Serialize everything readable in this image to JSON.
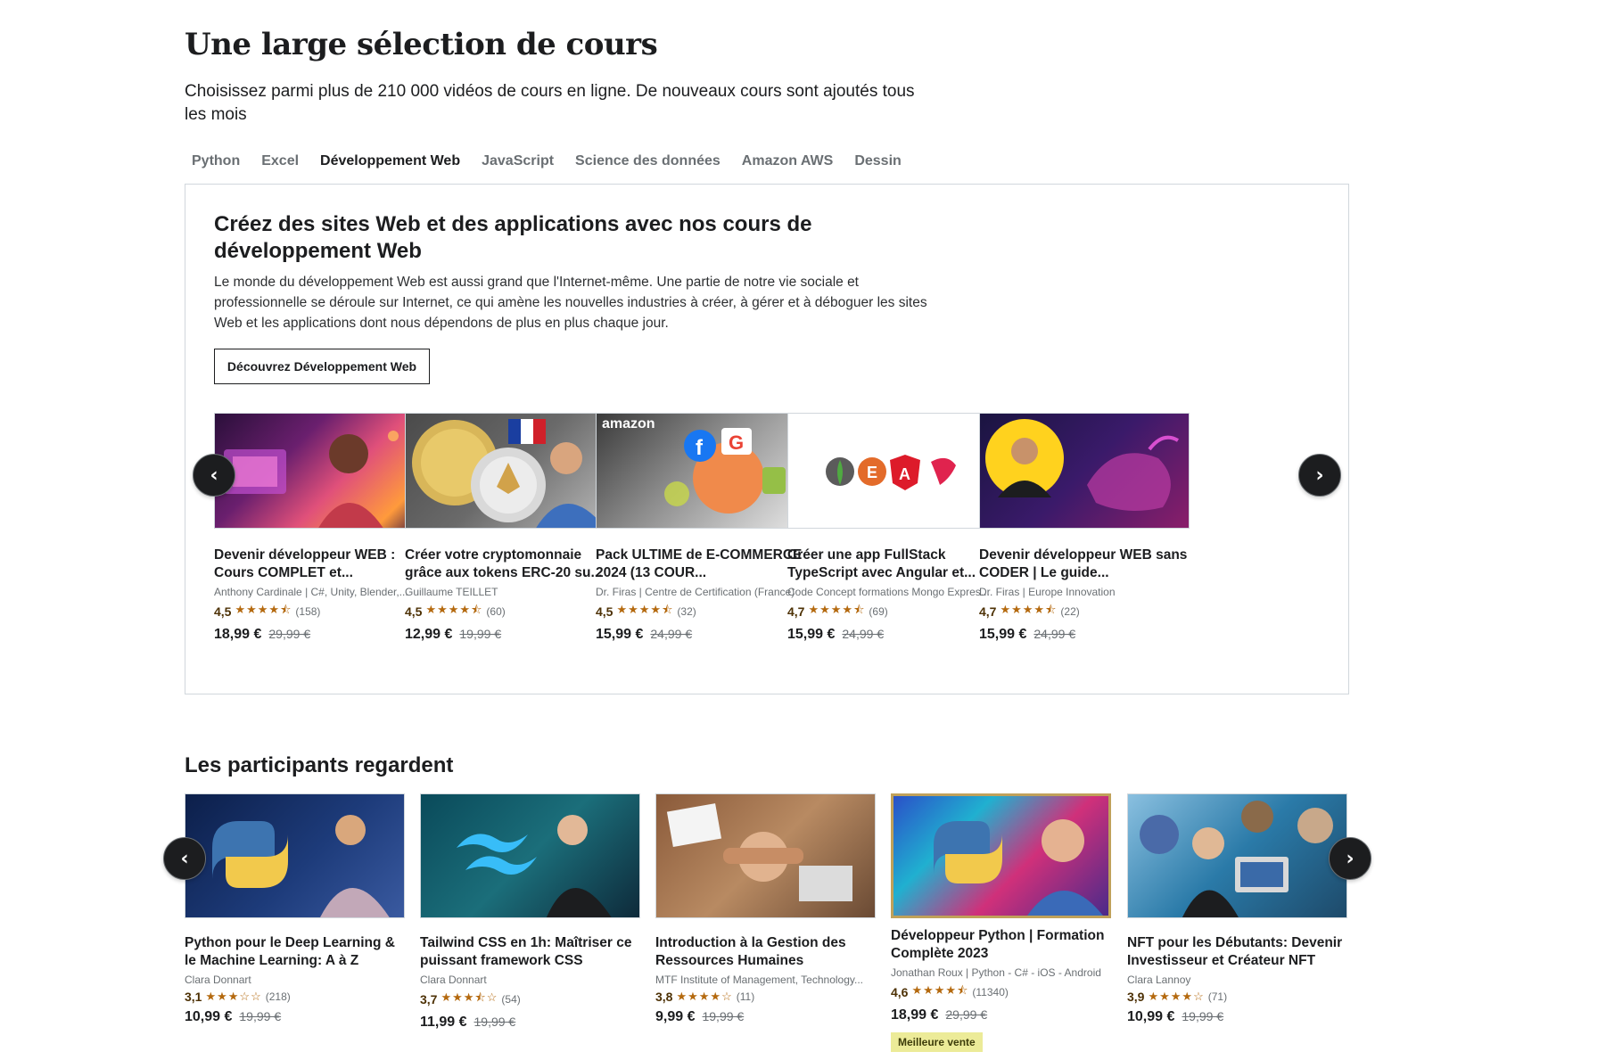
{
  "header": {
    "title": "Une large sélection de cours",
    "subtitle": "Choisissez parmi plus de 210 000 vidéos de cours en ligne. De nouveaux cours sont ajoutés tous les mois"
  },
  "tabs": [
    {
      "label": "Python"
    },
    {
      "label": "Excel"
    },
    {
      "label": "Développement Web"
    },
    {
      "label": "JavaScript"
    },
    {
      "label": "Science des données"
    },
    {
      "label": "Amazon AWS"
    },
    {
      "label": "Dessin"
    }
  ],
  "active_tab": "Développement Web",
  "panel": {
    "heading": "Créez des sites Web et des applications avec nos cours de développement Web",
    "description": "Le monde du développement Web est aussi grand que l'Internet-même. Une partie de notre vie sociale et professionnelle se déroule sur Internet, ce qui amène les nouvelles industries à créer, à gérer et à déboguer les sites Web et les applications dont nous dépendons de plus en plus chaque jour.",
    "button": "Découvrez Développement Web"
  },
  "web_courses": [
    {
      "title": "Devenir développeur WEB : Cours COMPLET et...",
      "author": "Anthony Cardinale | C#, Unity, Blender,...",
      "rating": "4,5",
      "stars": "★★★★⯪",
      "reviews": "(158)",
      "price": "18,99 €",
      "old_price": "29,99 €"
    },
    {
      "title": "Créer votre cryptomonnaie grâce aux tokens ERC-20 su...",
      "author": "Guillaume TEILLET",
      "rating": "4,5",
      "stars": "★★★★⯪",
      "reviews": "(60)",
      "price": "12,99 €",
      "old_price": "19,99 €"
    },
    {
      "title": "Pack ULTIME de E-COMMERCE 2024 (13 COUR...",
      "author": "Dr. Firas | Centre de Certification (France)",
      "rating": "4,5",
      "stars": "★★★★⯪",
      "reviews": "(32)",
      "price": "15,99 €",
      "old_price": "24,99 €"
    },
    {
      "title": "Créer une app FullStack TypeScript avec Angular et...",
      "author": "Code Concept formations Mongo Expres...",
      "rating": "4,7",
      "stars": "★★★★⯪",
      "reviews": "(69)",
      "price": "15,99 €",
      "old_price": "24,99 €"
    },
    {
      "title": "Devenir développeur WEB sans CODER | Le guide...",
      "author": "Dr. Firas | Europe Innovation",
      "rating": "4,7",
      "stars": "★★★★⯪",
      "reviews": "(22)",
      "price": "15,99 €",
      "old_price": "24,99 €"
    }
  ],
  "section2": {
    "title": "Les participants regardent"
  },
  "watched_courses": [
    {
      "title": "Python pour le Deep Learning & le Machine Learning: A à Z",
      "author": "Clara Donnart",
      "rating": "3,1",
      "stars": "★★★☆☆",
      "reviews": "(218)",
      "price": "10,99 €",
      "old_price": "19,99 €"
    },
    {
      "title": "Tailwind CSS en 1h: Maîtriser ce puissant framework CSS",
      "author": "Clara Donnart",
      "rating": "3,7",
      "stars": "★★★⯪☆",
      "reviews": "(54)",
      "price": "11,99 €",
      "old_price": "19,99 €"
    },
    {
      "title": "Introduction à la Gestion des Ressources Humaines",
      "author": "MTF Institute of Management, Technology...",
      "rating": "3,8",
      "stars": "★★★★☆",
      "reviews": "(11)",
      "price": "9,99 €",
      "old_price": "19,99 €"
    },
    {
      "title": "Développeur Python | Formation Complète 2023",
      "author": "Jonathan Roux | Python - C# - iOS - Android",
      "rating": "4,6",
      "stars": "★★★★⯪",
      "reviews": "(11340)",
      "price": "18,99 €",
      "old_price": "29,99 €",
      "badge": "Meilleure vente"
    },
    {
      "title": "NFT pour les Débutants: Devenir Investisseur et Créateur NFT",
      "author": "Clara Lannoy",
      "rating": "3,9",
      "stars": "★★★★☆",
      "reviews": "(71)",
      "price": "10,99 €",
      "old_price": "19,99 €"
    }
  ],
  "thumb_labels": {
    "amazon": "amazon"
  },
  "icons": {
    "prev": "‹",
    "next": "›"
  },
  "colors": {
    "text": "#1c1d1f",
    "muted": "#6a6f73",
    "star": "#b4690e",
    "badge_bg": "#eceb98"
  }
}
